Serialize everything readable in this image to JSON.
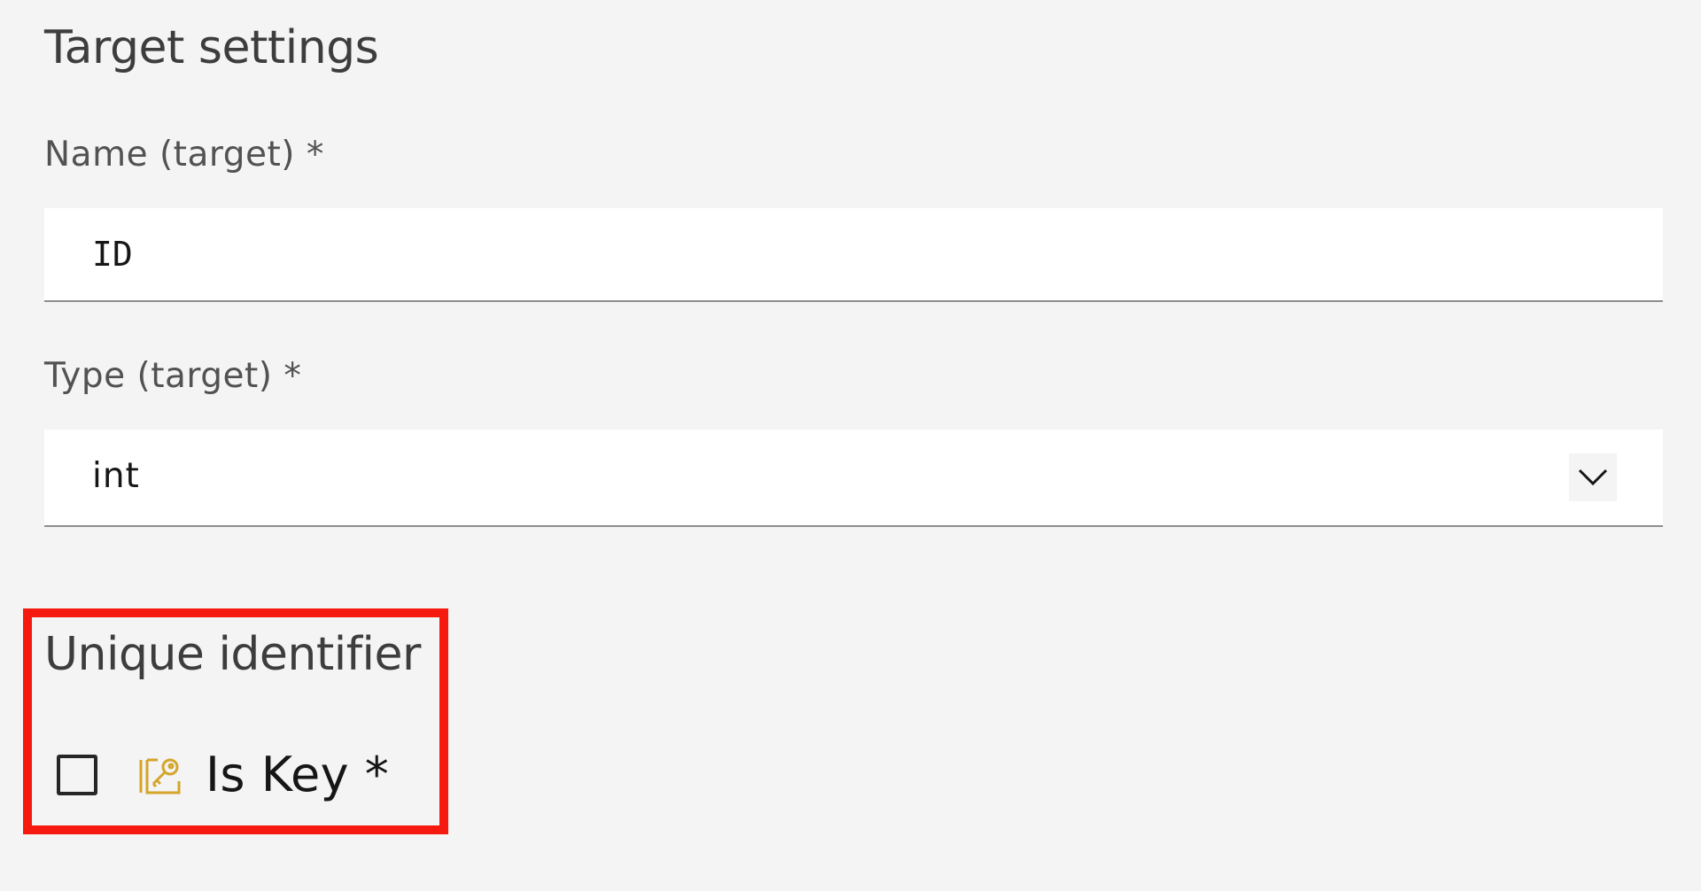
{
  "section": {
    "title": "Target settings"
  },
  "name_field": {
    "label": "Name (target) *",
    "value": "ID"
  },
  "type_field": {
    "label": "Type (target) *",
    "selected": "int",
    "icon": "chevron-down-icon"
  },
  "unique_identifier": {
    "title": "Unique identifier",
    "checkbox_label": "Is Key *",
    "checked": false,
    "icon": "key-edit-icon",
    "icon_color": "#d4a52a"
  },
  "colors": {
    "background": "#f4f4f4",
    "field_background": "#ffffff",
    "highlight": "#f5190f"
  }
}
